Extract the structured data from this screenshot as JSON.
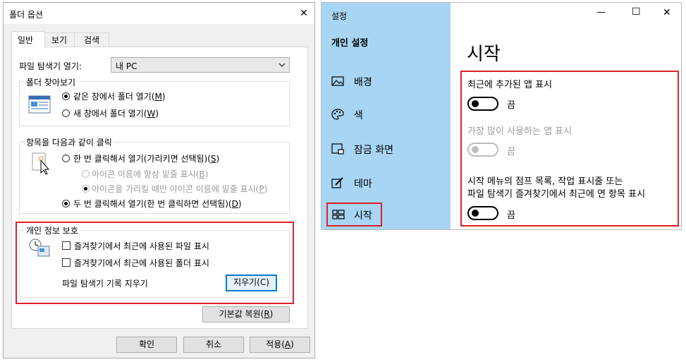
{
  "folder_options": {
    "title": "폴더 옵션",
    "close_glyph": "✕",
    "tabs": [
      "일반",
      "보기",
      "검색"
    ],
    "open_explorer_label": "파일 탐색기 열기:",
    "open_explorer_value": "내 PC",
    "browse_group": {
      "legend": "폴더 찾아보기",
      "opt_same_prefix": "같은 창에서 폴더 열기(",
      "opt_same_key": "M",
      "opt_new_prefix": "새 창에서 폴더 열기(",
      "opt_new_key": "W"
    },
    "click_group": {
      "legend": "항목을 다음과 같이 클릭",
      "single_prefix": "한 번 클릭해서 열기(가리키면 선택됨)(",
      "single_key": "S",
      "underline_always_prefix": "아이콘 이름에 항상 밑줄 표시(",
      "underline_always_key": "B",
      "underline_hover_prefix": "아이콘을 가리킬 때만 아이콘 이름에 밑줄 표시(",
      "underline_hover_key": "P",
      "double_prefix": "두 번 클릭해서 열기(한 번 클릭하면 선택됨)(",
      "double_key": "D"
    },
    "privacy_group": {
      "legend": "개인 정보 보호",
      "recent_files": "즐겨찾기에서 최근에 사용된 파일 표시",
      "recent_folders": "즐겨찾기에서 최근에 사용된 폴더 표시",
      "clear_history_label": "파일 탐색기 기록 지우기",
      "clear_button": "지우기(C)"
    },
    "restore_prefix": "기본값 복원(",
    "restore_key": "R",
    "ok_button": "확인",
    "cancel_button": "취소",
    "apply_prefix": "적용(",
    "apply_key": "A"
  },
  "settings": {
    "app_title": "설정",
    "section_title": "개인 설정",
    "nav": [
      {
        "label": "배경",
        "icon": "picture-icon"
      },
      {
        "label": "색",
        "icon": "palette-icon"
      },
      {
        "label": "잠금 화면",
        "icon": "lock-screen-icon"
      },
      {
        "label": "테마",
        "icon": "theme-brush-icon"
      },
      {
        "label": "시작",
        "icon": "start-menu-icon"
      }
    ],
    "page_title": "시작",
    "opt1_label": "최근에 추가된 앱 표시",
    "opt1_state": "끔",
    "opt2_label": "가장 많이 사용하는 앱 표시",
    "opt2_state": "끔",
    "opt3_label_line1": "시작 메뉴의 점프 목록, 작업 표시줄 또는",
    "opt3_label_line2": "파일 탐색기 즐겨찾기에서 최근에 연 항목 표시",
    "opt3_state": "끔",
    "minimize_glyph": "—",
    "maximize_glyph": "☐",
    "close_glyph": "✕"
  },
  "colors": {
    "highlight_red": "#e0202b",
    "settings_sidebar": "#a7d5f3",
    "focus_blue": "#0078d7"
  }
}
